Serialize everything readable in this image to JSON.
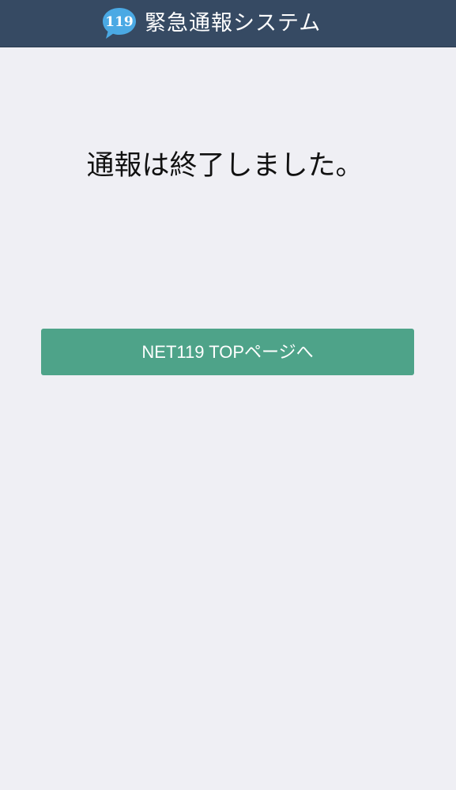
{
  "header": {
    "logo_text": "119",
    "title": "緊急通報システム"
  },
  "main": {
    "message": "通報は終了しました。",
    "top_button_label": "NET119 TOPページへ"
  },
  "colors": {
    "header_bg": "#364a63",
    "page_bg": "#efeff4",
    "button_bg": "#4ea389",
    "logo_bubble": "#4aa9e4"
  }
}
